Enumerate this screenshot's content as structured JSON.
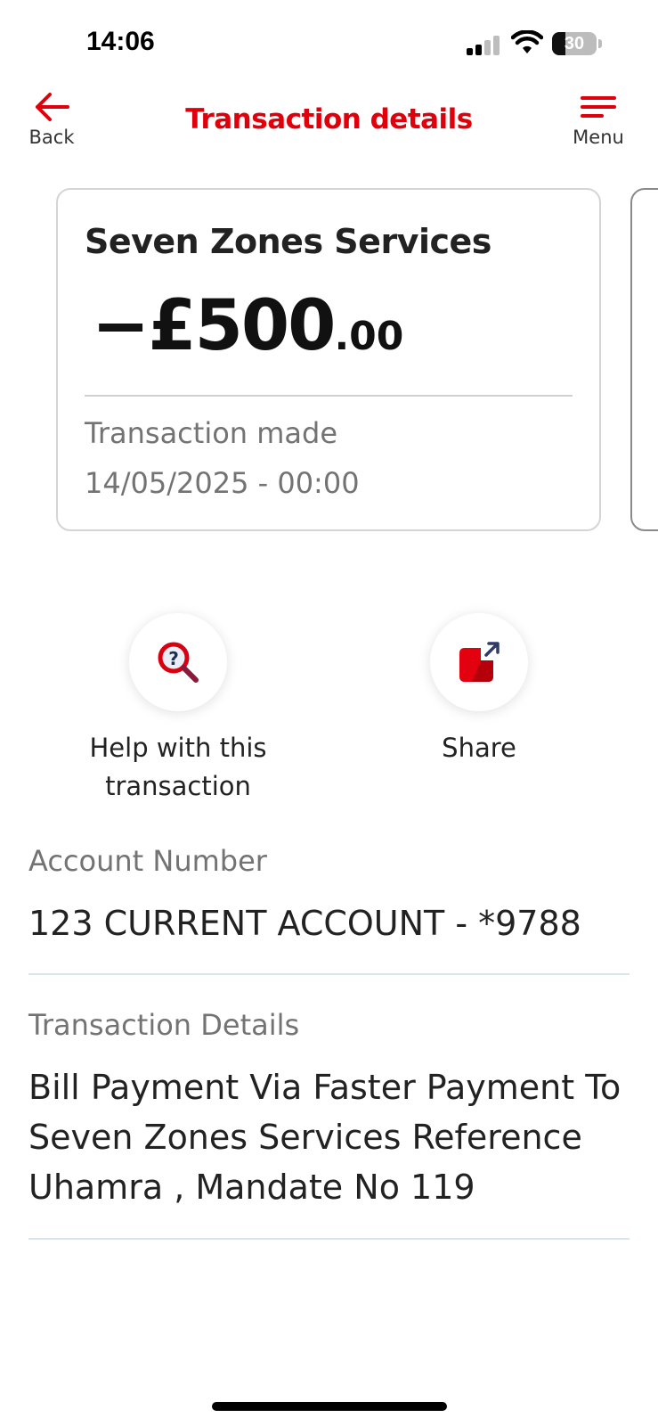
{
  "status_bar": {
    "time": "14:06",
    "battery_level": "30",
    "icons": [
      "cellular-signal-icon",
      "wifi-icon",
      "battery-icon"
    ]
  },
  "header": {
    "back_label": "Back",
    "title": "Transaction details",
    "menu_label": "Menu",
    "accent_color": "#e0000b"
  },
  "transaction_card": {
    "merchant": "Seven Zones Services",
    "amount_main": "−£500",
    "amount_decimal": ".00",
    "made_label": "Transaction made",
    "made_datetime": "14/05/2025 - 00:00"
  },
  "actions": [
    {
      "label": "Help with this transaction",
      "icon": "help-magnifier-icon"
    },
    {
      "label": "Share",
      "icon": "share-icon"
    }
  ],
  "details": {
    "account_number_label": "Account Number",
    "account_number_value": "123 CURRENT ACCOUNT - *9788",
    "transaction_details_label": "Transaction Details",
    "transaction_details_value": "Bill Payment Via Faster Payment To Seven Zones Services Reference Uhamra , Mandate No 119"
  }
}
